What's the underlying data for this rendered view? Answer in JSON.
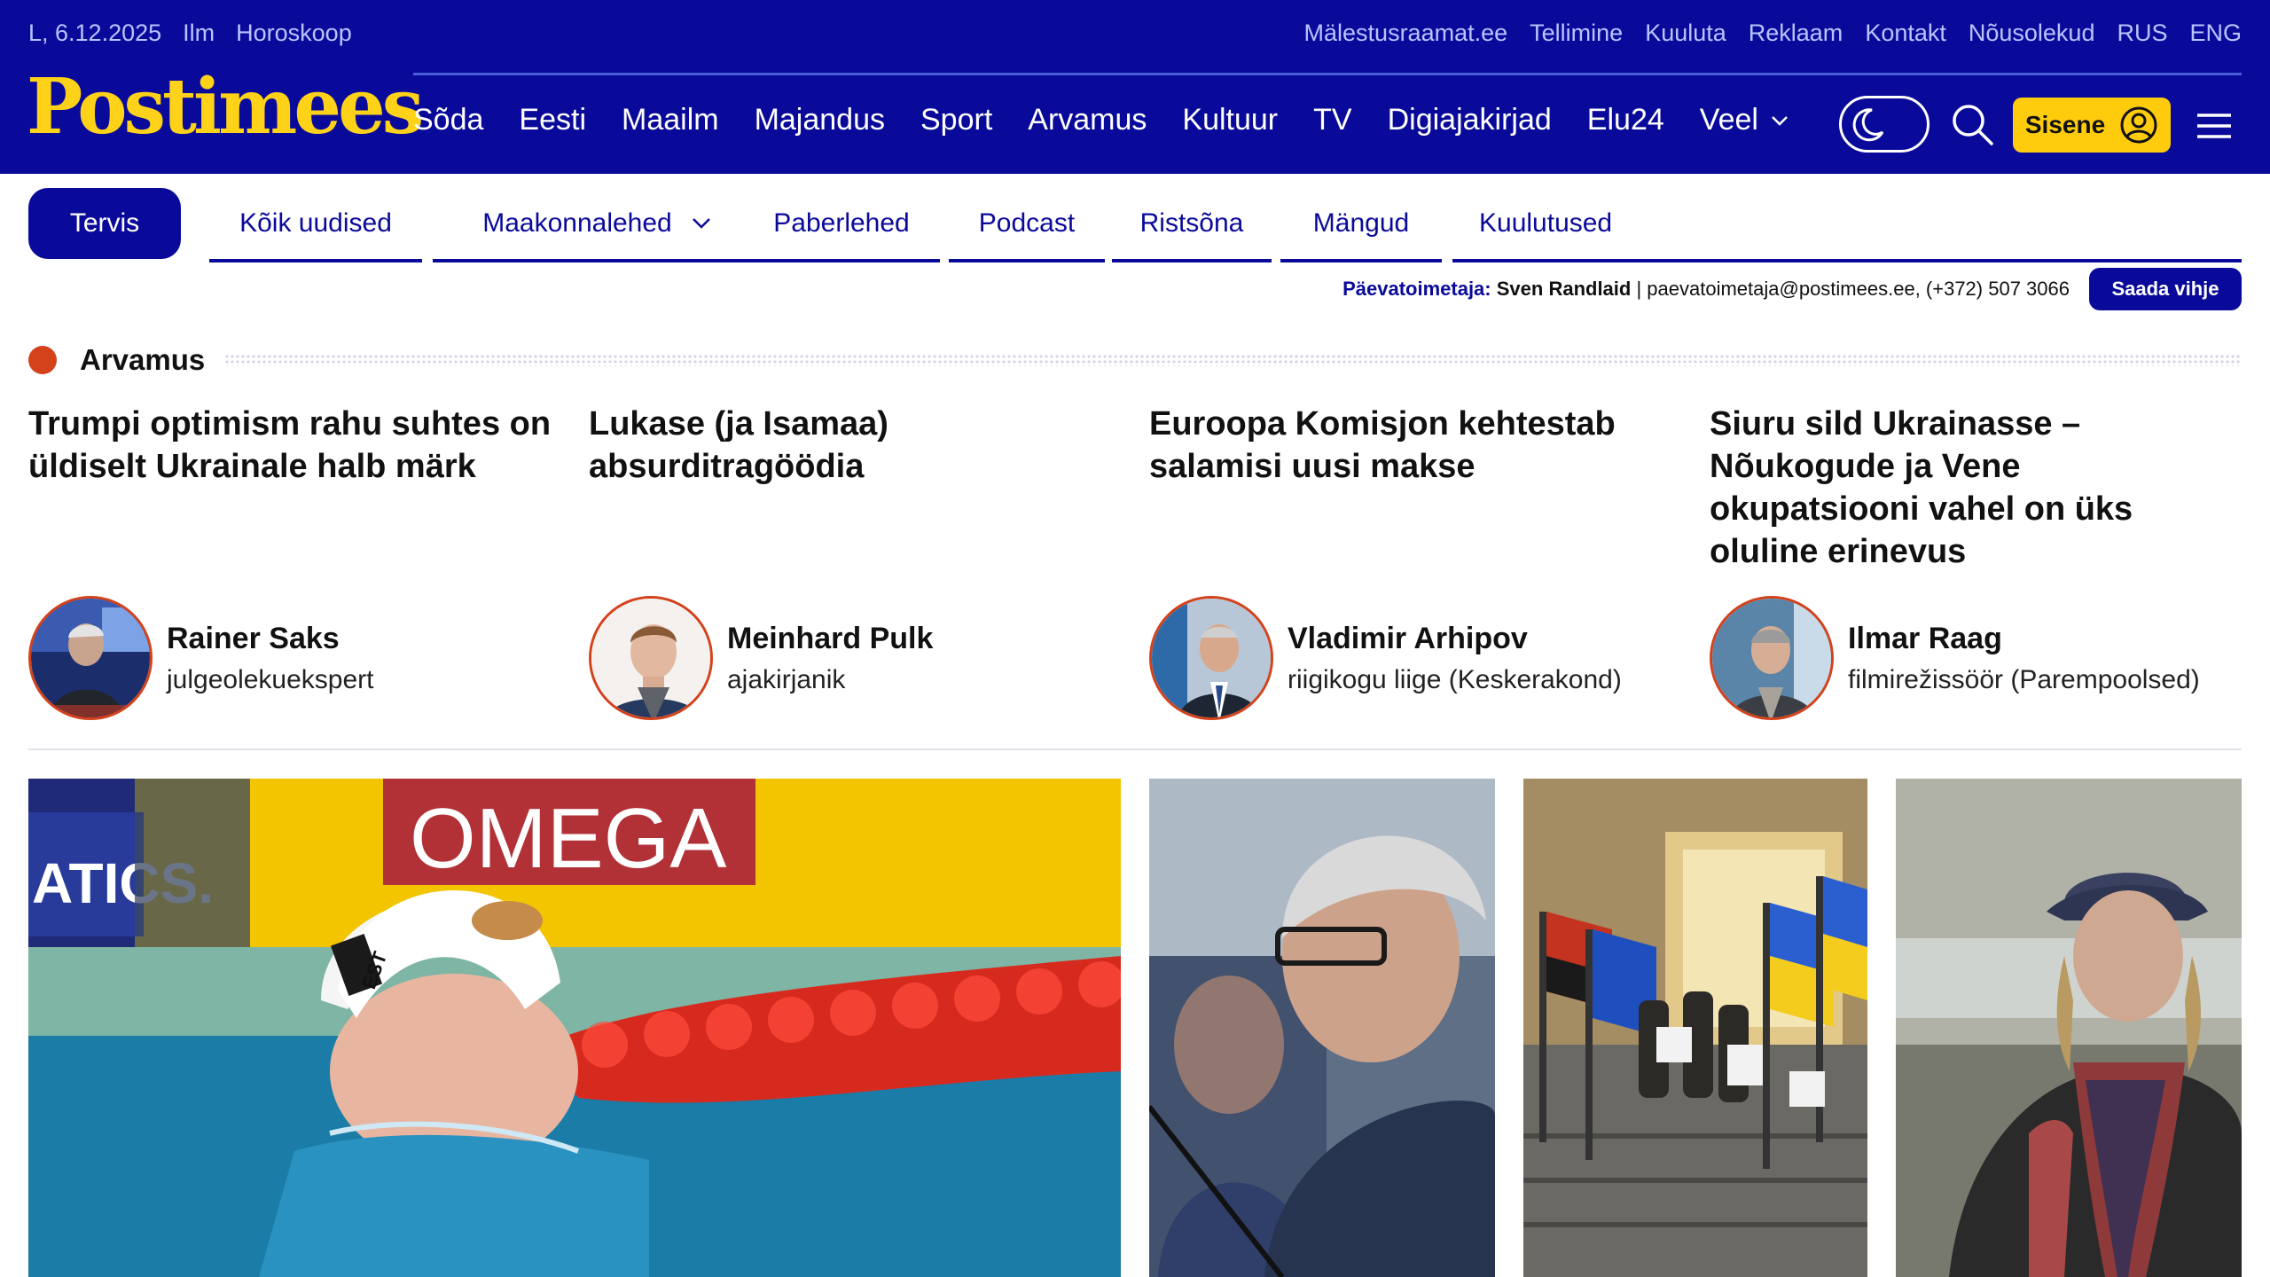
{
  "topbar": {
    "left": [
      "L, 6.12.2025",
      "Ilm",
      "Horoskoop"
    ],
    "right": [
      "Mälestusraamat.ee",
      "Tellimine",
      "Kuuluta",
      "Reklaam",
      "Kontakt",
      "Nõusolekud",
      "RUS",
      "ENG"
    ]
  },
  "logo": "Postimees",
  "mainnav": [
    "Sõda",
    "Eesti",
    "Maailm",
    "Majandus",
    "Sport",
    "Arvamus",
    "Kultuur",
    "TV",
    "Digiajakirjad",
    "Elu24",
    "Veel"
  ],
  "login": "Sisene",
  "subnav": {
    "active": "Tervis",
    "tabs": [
      "Kõik uudised",
      "Maakonnalehed",
      "Paberlehed",
      "Podcast",
      "Ristsõna",
      "Mängud",
      "Kuulutused"
    ]
  },
  "editor": {
    "label": "Päevatoimetaja:",
    "name": "Sven Randlaid",
    "contact": "paevatoimetaja@postimees.ee, (+372) 507 3066",
    "tip_button": "Saada vihje"
  },
  "opinion": {
    "heading": "Arvamus",
    "articles": [
      {
        "title": "Trumpi optimism rahu suhtes on üldiselt Ukrainale halb märk",
        "author": "Rainer Saks",
        "role": "julgeolekuekspert"
      },
      {
        "title": "Lukase (ja Isamaa) absurditragöödia",
        "author": "Meinhard Pulk",
        "role": "ajakirjanik"
      },
      {
        "title": "Euroopa Komisjon kehtestab salamisi uusi makse",
        "author": "Vladimir Arhipov",
        "role": "riigikogu liige (Keskerakond)"
      },
      {
        "title": "Siuru sild Ukrainasse – Nõukogude ja Vene okupatsiooni vahel on üks oluline erinevus",
        "author": "Ilmar Raag",
        "role": "filmirežissöör (Parempoolsed)"
      }
    ]
  },
  "photos": {
    "swim_banner_left": "ATICS.",
    "swim_banner_right": "OMEGA",
    "cap_text": "EST"
  },
  "colors": {
    "brand_blue": "#0a0a9a",
    "logo_yellow": "#ffd21a",
    "accent_red": "#d4421c",
    "login_yellow": "#ffcc0d"
  }
}
